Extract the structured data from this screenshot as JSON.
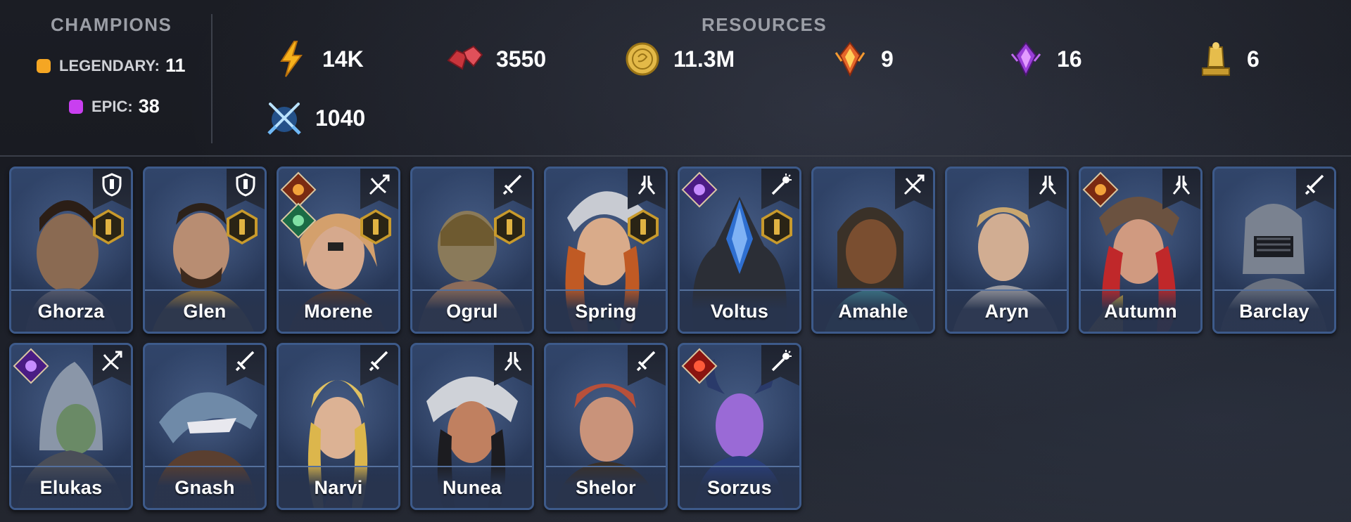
{
  "champions": {
    "title": "CHAMPIONS",
    "legendary": {
      "label": "LEGENDARY:",
      "count": "11",
      "color": "#f5a623"
    },
    "epic": {
      "label": "EPIC:",
      "count": "38",
      "color": "#c93ff0"
    }
  },
  "resources": {
    "title": "RESOURCES",
    "items": [
      {
        "icon": "energy-icon",
        "value": "14K"
      },
      {
        "icon": "rubies-icon",
        "value": "3550"
      },
      {
        "icon": "gold-coin-icon",
        "value": "11.3M"
      },
      {
        "icon": "fire-crystal-icon",
        "value": "9"
      },
      {
        "icon": "void-crystal-icon",
        "value": "16"
      },
      {
        "icon": "gold-trophy-icon",
        "value": "6"
      },
      {
        "icon": "crossed-swords-icon",
        "value": "1040"
      }
    ]
  },
  "cards": [
    {
      "name": "Ghorza",
      "role": "shield-icon",
      "level_badge": true,
      "affinity": []
    },
    {
      "name": "Glen",
      "role": "shield-icon",
      "level_badge": true,
      "affinity": []
    },
    {
      "name": "Morene",
      "role": "crossbow-icon",
      "level_badge": true,
      "affinity": [
        "fire",
        "nature"
      ]
    },
    {
      "name": "Ogrul",
      "role": "sword-icon",
      "level_badge": true,
      "affinity": []
    },
    {
      "name": "Spring",
      "role": "praying-hands-icon",
      "level_badge": true,
      "affinity": []
    },
    {
      "name": "Voltus",
      "role": "magic-staff-icon",
      "level_badge": true,
      "affinity": [
        "void"
      ]
    },
    {
      "name": "Amahle",
      "role": "crossbow-icon",
      "level_badge": false,
      "affinity": []
    },
    {
      "name": "Aryn",
      "role": "praying-hands-icon",
      "level_badge": false,
      "affinity": []
    },
    {
      "name": "Autumn",
      "role": "praying-hands-icon",
      "level_badge": false,
      "affinity": [
        "fire"
      ]
    },
    {
      "name": "Barclay",
      "role": "sword-icon",
      "level_badge": false,
      "affinity": []
    },
    {
      "name": "Elukas",
      "role": "crossbow-icon",
      "level_badge": false,
      "affinity": [
        "void"
      ]
    },
    {
      "name": "Gnash",
      "role": "sword-icon",
      "level_badge": false,
      "affinity": []
    },
    {
      "name": "Narvi",
      "role": "sword-icon",
      "level_badge": false,
      "affinity": []
    },
    {
      "name": "Nunea",
      "role": "praying-hands-icon",
      "level_badge": false,
      "affinity": []
    },
    {
      "name": "Shelor",
      "role": "sword-icon",
      "level_badge": false,
      "affinity": []
    },
    {
      "name": "Sorzus",
      "role": "magic-staff-icon",
      "level_badge": false,
      "affinity": [
        "fire-red"
      ]
    }
  ],
  "colors": {
    "card_border": "#3d5a8a",
    "gold_badge": "#c89a2c",
    "fire": "#e0722a",
    "nature": "#2f9e63",
    "void": "#8a4be0",
    "fire-red": "#c7241f"
  }
}
